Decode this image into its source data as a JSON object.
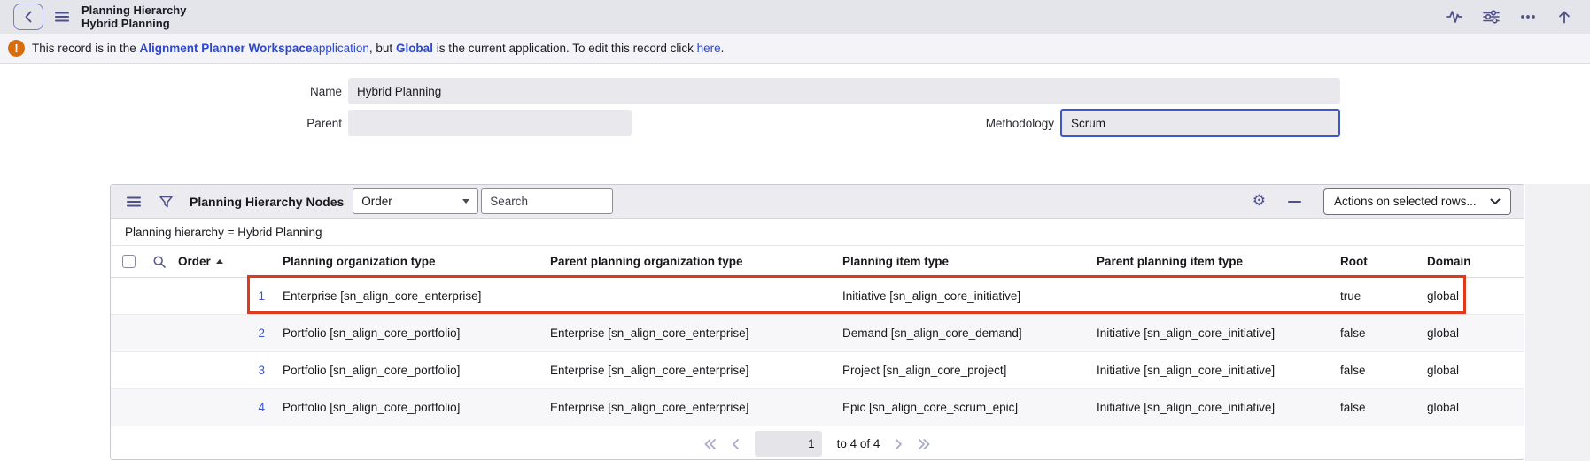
{
  "header": {
    "title": "Planning Hierarchy",
    "subtitle": "Hybrid Planning"
  },
  "banner": {
    "text_1": "This record is in the ",
    "link_app": "Alignment Planner Workspace",
    "link_app_suffix": " application",
    "text_2": ", but ",
    "link_scope": "Global",
    "text_3": " is the current application. To edit this record click ",
    "link_here": "here",
    "text_4": "."
  },
  "form": {
    "name": {
      "label": "Name",
      "value": "Hybrid Planning"
    },
    "parent": {
      "label": "Parent",
      "value": ""
    },
    "methodology": {
      "label": "Methodology",
      "value": "Scrum"
    }
  },
  "list": {
    "title": "Planning Hierarchy Nodes",
    "search_field": "Order",
    "search_placeholder": "Search",
    "actions_label": "Actions on selected rows...",
    "filter": "Planning hierarchy = Hybrid Planning",
    "columns": [
      "Order",
      "Planning organization type",
      "Parent planning organization type",
      "Planning item type",
      "Parent planning item type",
      "Root",
      "Domain"
    ],
    "rows": [
      {
        "order": "1",
        "planning_organization_type": "Enterprise [sn_align_core_enterprise]",
        "parent_planning_organization_type": "",
        "planning_item_type": "Initiative [sn_align_core_initiative]",
        "parent_planning_item_type": "",
        "root": "true",
        "domain": "global"
      },
      {
        "order": "2",
        "planning_organization_type": "Portfolio [sn_align_core_portfolio]",
        "parent_planning_organization_type": "Enterprise [sn_align_core_enterprise]",
        "planning_item_type": "Demand [sn_align_core_demand]",
        "parent_planning_item_type": "Initiative [sn_align_core_initiative]",
        "root": "false",
        "domain": "global"
      },
      {
        "order": "3",
        "planning_organization_type": "Portfolio [sn_align_core_portfolio]",
        "parent_planning_organization_type": "Enterprise [sn_align_core_enterprise]",
        "planning_item_type": "Project [sn_align_core_project]",
        "parent_planning_item_type": "Initiative [sn_align_core_initiative]",
        "root": "false",
        "domain": "global"
      },
      {
        "order": "4",
        "planning_organization_type": "Portfolio [sn_align_core_portfolio]",
        "parent_planning_organization_type": "Enterprise [sn_align_core_enterprise]",
        "planning_item_type": "Epic [sn_align_core_scrum_epic]",
        "parent_planning_item_type": "Initiative [sn_align_core_initiative]",
        "root": "false",
        "domain": "global"
      }
    ],
    "pagination": {
      "page": "1",
      "range": "to 4 of 4"
    }
  },
  "colors": {
    "link_blue": "#2c47cb",
    "focus_border": "#3f56cc",
    "alert_orange": "#d96c0d",
    "annotation_red": "#de3a1e",
    "icon_indigo": "#4f4f8a",
    "row_number_blue": "#3d55c9",
    "topbar_bg": "#e4e4eb",
    "toolbar_bg": "#ebebf0"
  }
}
